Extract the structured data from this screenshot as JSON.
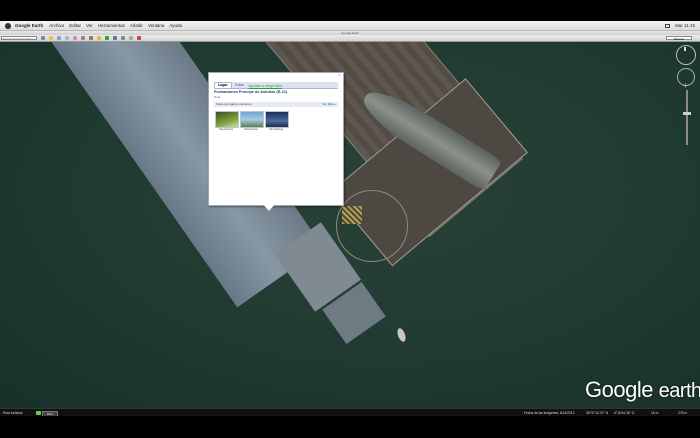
{
  "menubar": {
    "app": "Google Earth",
    "items": [
      "Archivo",
      "Editar",
      "Ver",
      "Herramientas",
      "Añadir",
      "Ventana",
      "Ayuda"
    ],
    "status": [
      "Mar 11:15"
    ]
  },
  "window": {
    "title": "Google Earth"
  },
  "toolbar": {
    "search_value": "Introducir la ruta. Ejem",
    "search_button": "Buscar"
  },
  "balloon": {
    "close": "×",
    "tabs": [
      "Lugar",
      "Fotos"
    ],
    "tab_link": "Ayúdale a elegir fotos",
    "title": "Portaaviones Príncipe de Asturias (R-11)",
    "subtitle": "Rota",
    "section_label": "Fotos de lugares cercanos",
    "section_more": "Ver Más »",
    "photos": [
      "Panorámica",
      "Panorámica",
      "Panorámica"
    ]
  },
  "logo": {
    "google": "Google",
    "earth": "earth"
  },
  "statusbar": {
    "tour": "Ruta turística",
    "badge": "2012",
    "imagery_date": "Fecha de las imágenes: 8/14/2012",
    "lat": "36°37'10.37\" N",
    "lon": "6°16'44.36\" O",
    "elev": "16 m",
    "eye_alt": "278 m"
  },
  "colors": {
    "water": "#1f3a31",
    "pier": "#5d574f",
    "carrier_deck": "#8d9cab",
    "balloon_title": "#1a3a86",
    "link_green": "#2fa02b"
  }
}
